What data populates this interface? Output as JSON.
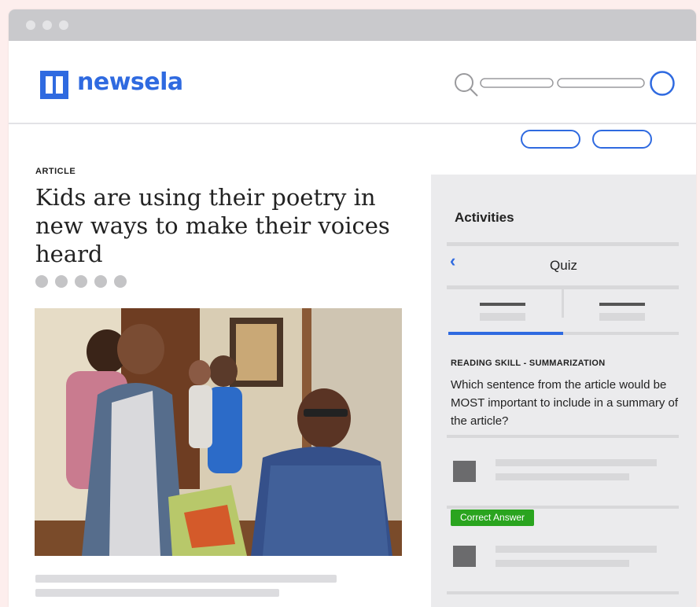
{
  "brand": {
    "name": "newsela",
    "color": "#2f6ae0"
  },
  "header": {
    "icons": [
      "search-icon",
      "avatar-icon"
    ]
  },
  "article": {
    "kicker": "ARTICLE",
    "title": "Kids are using their poetry in new ways to make their voices heard",
    "photo_icon": "photo-placeholder"
  },
  "activities": {
    "title": "Activities",
    "quiz_title": "Quiz",
    "back_icon": "chevron-left-icon",
    "back_glyph": "‹",
    "skill_label": "READING SKILL - SUMMARIZATION",
    "question": "Which sentence from the article would be MOST important to include in a summary of the article?",
    "correct_badge": "Correct Answer",
    "correct_color": "#2aa41f"
  }
}
